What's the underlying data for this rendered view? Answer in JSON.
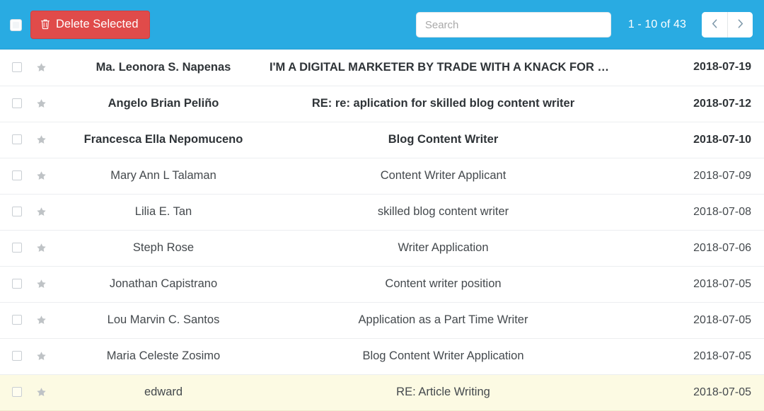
{
  "toolbar": {
    "select_all_label": "Select all",
    "delete_label": "Delete Selected",
    "trash_icon": "trash-icon",
    "search": {
      "placeholder": "Search",
      "value": ""
    },
    "pagination": {
      "range_label": "1 - 10 of 43",
      "prev_icon": "chevron-left-icon",
      "next_icon": "chevron-right-icon",
      "prev_label": "Previous page",
      "next_label": "Next page"
    },
    "accent_color": "#29ABE2",
    "delete_button_color": "#E04B4A"
  },
  "list": {
    "star_icon": "star-icon",
    "checkbox_icon": "checkbox-icon",
    "highlight_color": "#FCFAE3",
    "rows": [
      {
        "name": "Ma. Leonora S. Napenas",
        "subject": "I'M A DIGITAL MARKETER BY TRADE WITH A KNACK FOR WRITING",
        "date": "2018-07-19",
        "unread": true,
        "highlighted": false,
        "starred": false
      },
      {
        "name": "Angelo Brian Peliño",
        "subject": "RE: re: aplication for skilled blog content writer",
        "date": "2018-07-12",
        "unread": true,
        "highlighted": false,
        "starred": false
      },
      {
        "name": "Francesca Ella Nepomuceno",
        "subject": "Blog Content Writer",
        "date": "2018-07-10",
        "unread": true,
        "highlighted": false,
        "starred": false
      },
      {
        "name": "Mary Ann L Talaman",
        "subject": "Content Writer Applicant",
        "date": "2018-07-09",
        "unread": false,
        "highlighted": false,
        "starred": false
      },
      {
        "name": "Lilia E. Tan",
        "subject": "skilled blog content writer",
        "date": "2018-07-08",
        "unread": false,
        "highlighted": false,
        "starred": false
      },
      {
        "name": "Steph Rose",
        "subject": "Writer Application",
        "date": "2018-07-06",
        "unread": false,
        "highlighted": false,
        "starred": false
      },
      {
        "name": "Jonathan Capistrano",
        "subject": "Content writer position",
        "date": "2018-07-05",
        "unread": false,
        "highlighted": false,
        "starred": false
      },
      {
        "name": "Lou Marvin C. Santos",
        "subject": "Application as a Part Time Writer",
        "date": "2018-07-05",
        "unread": false,
        "highlighted": false,
        "starred": false
      },
      {
        "name": "Maria Celeste Zosimo",
        "subject": "Blog Content Writer Application",
        "date": "2018-07-05",
        "unread": false,
        "highlighted": false,
        "starred": false
      },
      {
        "name": "edward",
        "subject": "RE: Article Writing",
        "date": "2018-07-05",
        "unread": false,
        "highlighted": true,
        "starred": false
      }
    ]
  }
}
